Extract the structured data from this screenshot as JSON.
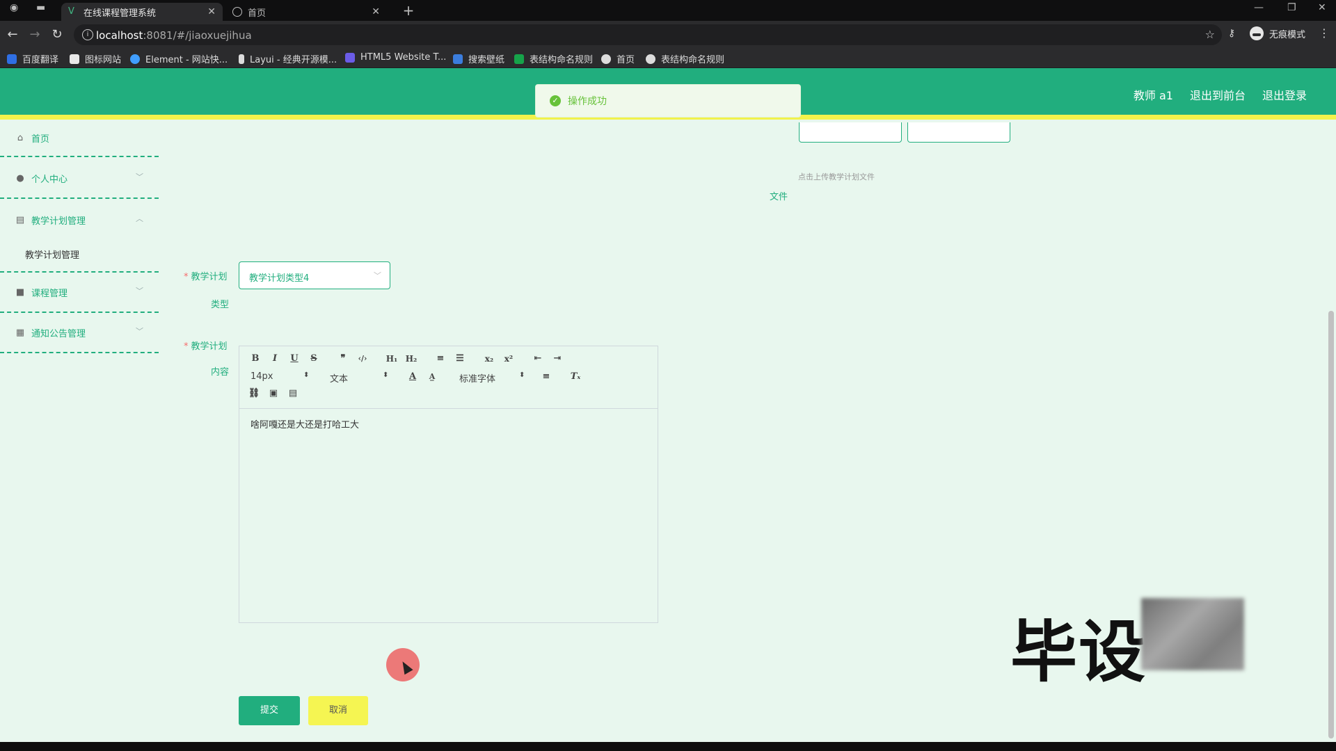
{
  "browser": {
    "tabs": [
      {
        "title": "在线课程管理系统",
        "active": true
      },
      {
        "title": "首页",
        "active": false
      }
    ],
    "new_tab": "+",
    "url_host": "localhost",
    "url_path": ":8081/#/jiaoxuejihua",
    "incognito_label": "无痕模式",
    "bookmarks": [
      {
        "label": "百度翻译",
        "color": "#2f6fe4"
      },
      {
        "label": "图标网站",
        "color": "#e8e8e8"
      },
      {
        "label": "Element - 网站快...",
        "color": "#409eff"
      },
      {
        "label": "Layui - 经典开源模...",
        "color": "#dcdcdc"
      },
      {
        "label": "HTML5 Website T...",
        "color": "#6b5ce7"
      },
      {
        "label": "搜索壁纸",
        "color": "#3b7ddd"
      },
      {
        "label": "表结构命名规则",
        "color": "#16a34a"
      },
      {
        "label": "首页",
        "color": "#dcdcdc"
      },
      {
        "label": "表结构命名规则",
        "color": "#dcdcdc"
      }
    ]
  },
  "header": {
    "user": "教师 a1",
    "to_front": "退出到前台",
    "logout": "退出登录",
    "toast": "操作成功",
    "bg_color": "#21ae7e"
  },
  "sidebar": {
    "items": [
      {
        "label": "首页",
        "icon": "home-icon"
      },
      {
        "label": "个人中心",
        "icon": "user-icon"
      },
      {
        "label": "教学计划管理",
        "icon": "document-icon"
      },
      {
        "label": "课程管理",
        "icon": "video-icon"
      },
      {
        "label": "通知公告管理",
        "icon": "grid-icon"
      }
    ],
    "submenu": {
      "label": "教学计划管理"
    }
  },
  "form": {
    "upload_tip": "点击上传教学计划文件",
    "file_label": "文件",
    "type_label_1": "教学计划",
    "type_label_2": "类型",
    "type_value": "教学计划类型4",
    "content_label_1": "教学计划",
    "content_label_2": "内容",
    "font_size": "14px",
    "text_style": "文本",
    "font_family": "标准字体",
    "content_text": "啥阿嘎还是大还是打哈工大",
    "submit": "提交",
    "cancel": "取消"
  },
  "watermark": "毕设"
}
